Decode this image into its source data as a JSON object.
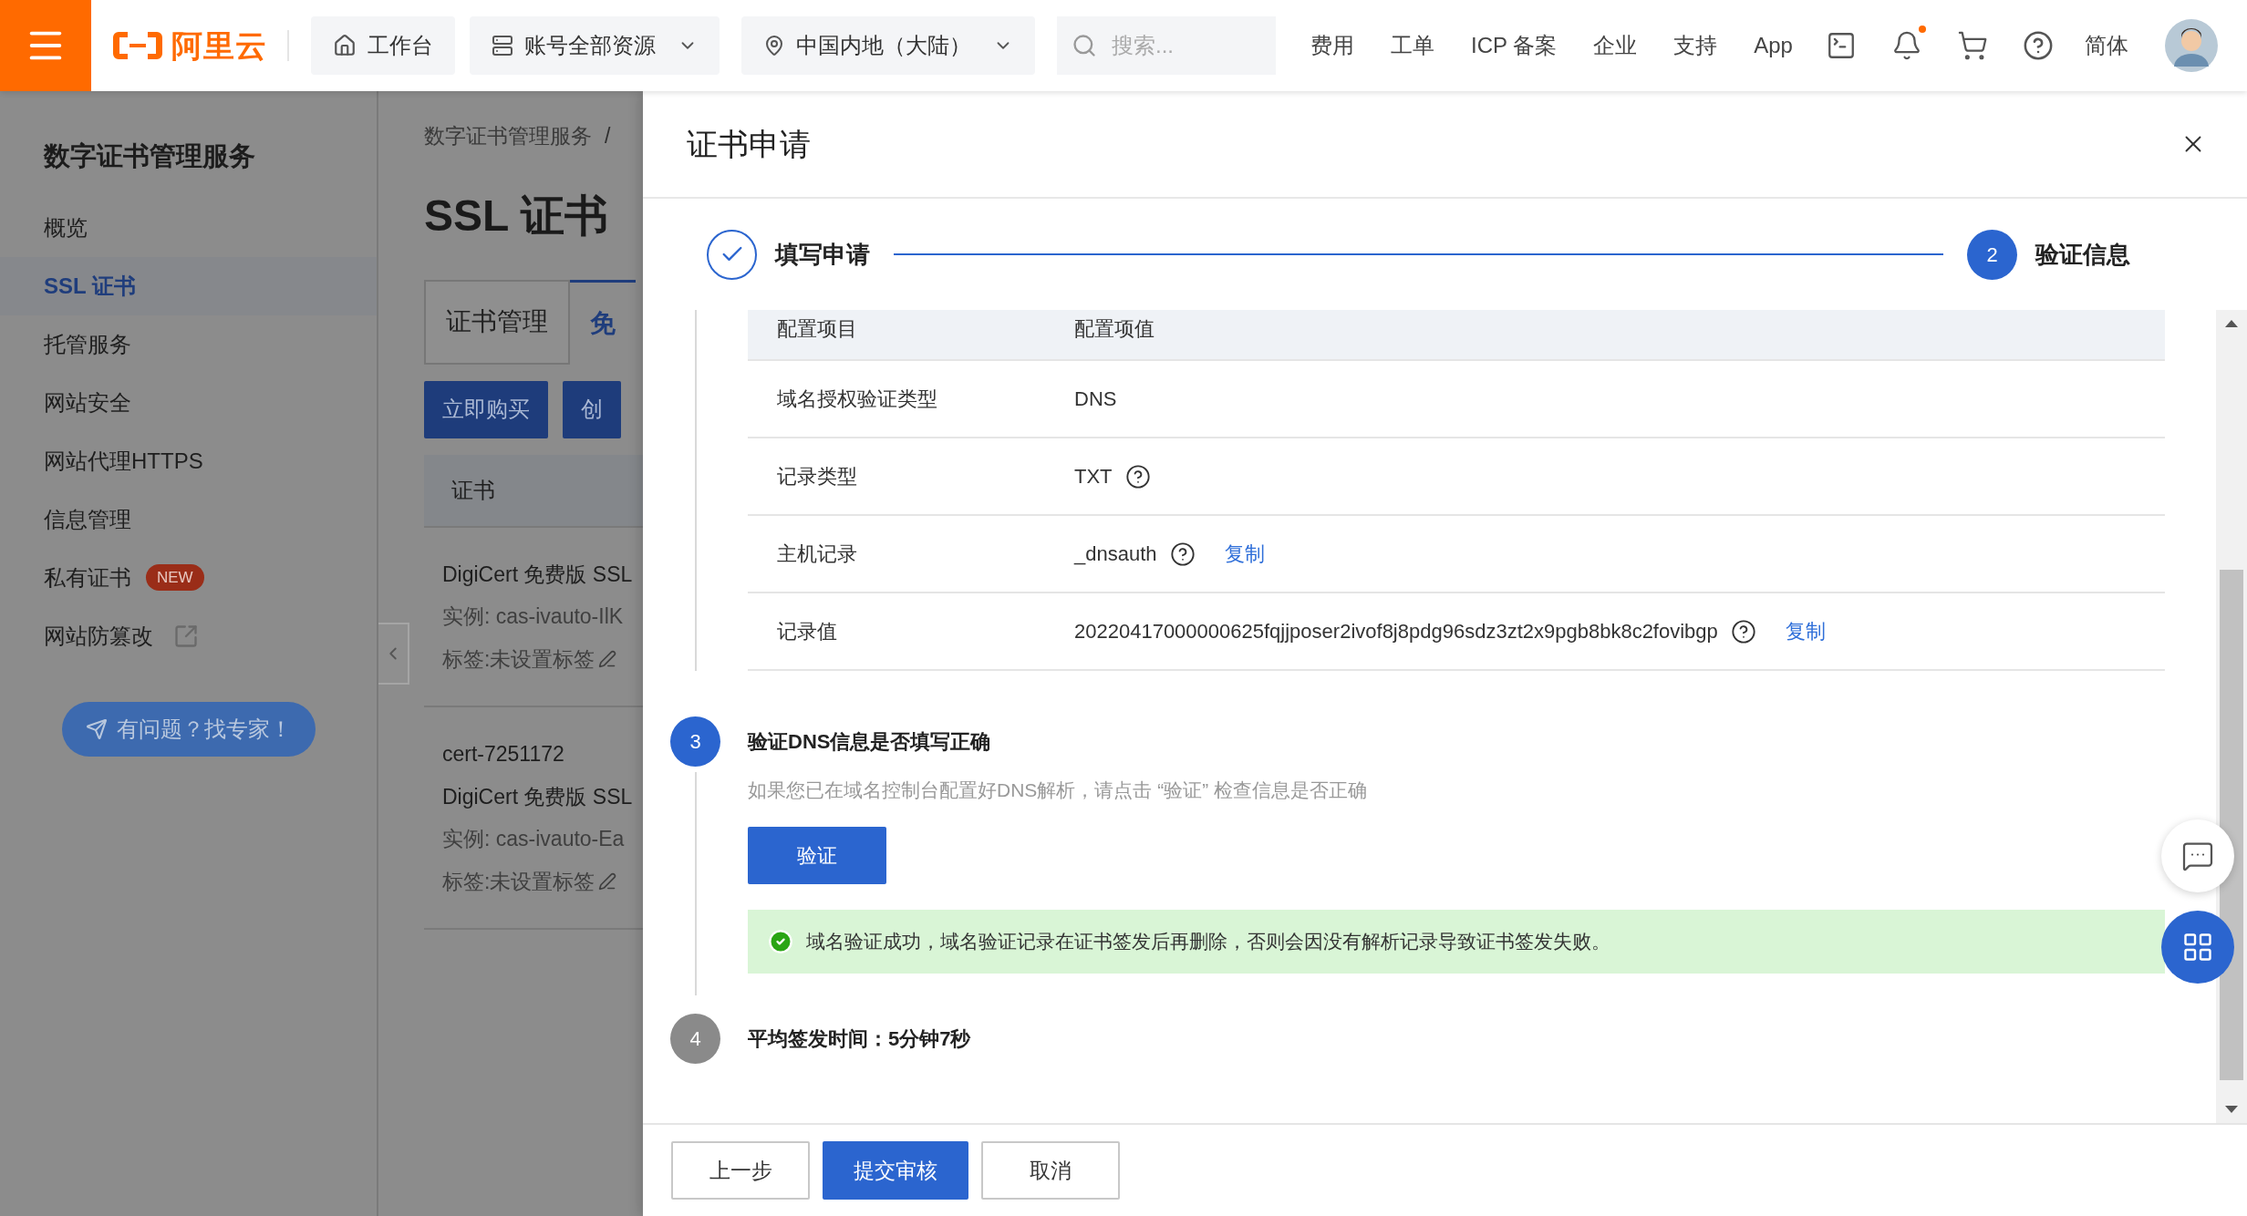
{
  "header": {
    "logo_text": "阿里云",
    "workbench": "工作台",
    "resources": "账号全部资源",
    "region": "中国内地（大陆）",
    "search": {
      "placeholder": "搜索..."
    },
    "links": [
      "费用",
      "工单",
      "ICP 备案",
      "企业",
      "支持",
      "App"
    ],
    "has_unread_notification": true,
    "language": "简体"
  },
  "sidebar": {
    "title": "数字证书管理服务",
    "items": [
      {
        "label": "概览",
        "selected": false
      },
      {
        "label": "SSL 证书",
        "selected": true
      },
      {
        "label": "托管服务",
        "selected": false
      },
      {
        "label": "网站安全",
        "selected": false
      },
      {
        "label": "网站代理HTTPS",
        "selected": false
      },
      {
        "label": "信息管理",
        "selected": false
      },
      {
        "label": "私有证书",
        "selected": false,
        "badge": "NEW"
      },
      {
        "label": "网站防篡改",
        "selected": false,
        "external": true
      }
    ],
    "help_button": "有问题？找专家！"
  },
  "page": {
    "breadcrumb": "数字证书管理服务",
    "breadcrumb_separator": "/",
    "title": "SSL 证书",
    "tabs": [
      {
        "label": "证书管理",
        "selected": false
      },
      {
        "label": "免",
        "selected": true
      }
    ],
    "buttons": [
      "立即购买",
      "创"
    ],
    "table_header": "证书",
    "certificates": [
      {
        "name": "DigiCert 免费版 SSL",
        "instance": "实例: cas-ivauto-IlK",
        "tags": "标签:未设置标签"
      },
      {
        "id": "cert-7251172",
        "name": "DigiCert 免费版 SSL",
        "instance": "实例: cas-ivauto-Ea",
        "tags": "标签:未设置标签"
      }
    ]
  },
  "drawer": {
    "title": "证书申请",
    "steps": [
      {
        "label": "填写申请",
        "done": true
      },
      {
        "label": "验证信息",
        "number": "2",
        "done": false
      }
    ],
    "table": {
      "columns": [
        "配置项目",
        "配置项值"
      ],
      "rows": [
        {
          "item": "域名授权验证类型",
          "value": "DNS",
          "help": false
        },
        {
          "item": "记录类型",
          "value": "TXT",
          "help": true
        },
        {
          "item": "主机记录",
          "value": "_dnsauth",
          "help": true,
          "action": "复制"
        },
        {
          "item": "记录值",
          "value": "20220417000000625fqjjposer2ivof8j8pdg96sdz3zt2x9pgb8bk8c2fovibgp",
          "help": true,
          "action": "复制"
        }
      ]
    },
    "sections": [
      {
        "number": "3",
        "active": true,
        "title": "验证DNS信息是否填写正确",
        "description": "如果您已在域名控制台配置好DNS解析，请点击 “验证” 检查信息是否正确",
        "button": "验证",
        "alert": {
          "kind": "success",
          "text": "域名验证成功，域名验证记录在证书签发后再删除，否则会因没有解析记录导致证书签发失败。"
        }
      },
      {
        "number": "4",
        "active": false,
        "title": "平均签发时间：5分钟7秒"
      }
    ],
    "footer_buttons": [
      {
        "label": "上一步",
        "kind": "default"
      },
      {
        "label": "提交审核",
        "kind": "primary"
      },
      {
        "label": "取消",
        "kind": "default"
      }
    ]
  }
}
